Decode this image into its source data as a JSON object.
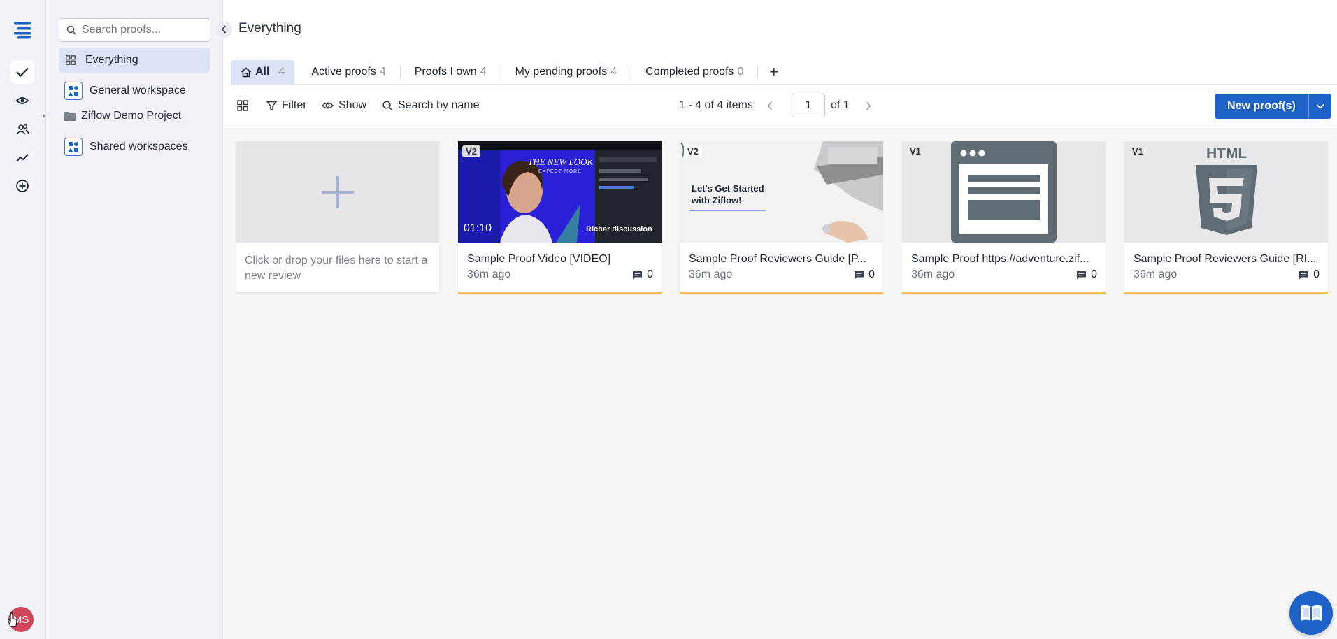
{
  "rail": {
    "avatar_initials": "MS"
  },
  "sidebar": {
    "search_placeholder": "Search proofs...",
    "items": [
      {
        "label": "Everything"
      },
      {
        "label": "General workspace"
      },
      {
        "label": "Ziflow Demo Project"
      },
      {
        "label": "Shared workspaces"
      }
    ]
  },
  "main": {
    "title": "Everything",
    "tabs": [
      {
        "label": "All",
        "count": "4"
      },
      {
        "label": "Active proofs",
        "count": "4"
      },
      {
        "label": "Proofs I own",
        "count": "4"
      },
      {
        "label": "My pending proofs",
        "count": "4"
      },
      {
        "label": "Completed proofs",
        "count": "0"
      }
    ],
    "tab_add": "+",
    "toolbar": {
      "filter": "Filter",
      "show": "Show",
      "search": "Search by name",
      "items_range": "1 - 4 of 4 items",
      "page": "1",
      "of_pages": "of 1",
      "new_button": "New proof(s)"
    },
    "upload_card": {
      "text": "Click or drop your files here to start a new review"
    },
    "cards": [
      {
        "version": "V2",
        "title": "Sample Proof Video [VIDEO]",
        "time": "36m ago",
        "comments": "0",
        "duration": "01:10",
        "thumb_headline": "THE NEW LOOK",
        "thumb_sub": "EXPECT MORE",
        "thumb_caption": "Richer discussion"
      },
      {
        "version": "V2",
        "title": "Sample Proof Reviewers Guide [P...",
        "time": "36m ago",
        "comments": "0",
        "thumb_line1": "Let's Get Started",
        "thumb_line2": "with Ziflow!"
      },
      {
        "version": "V1",
        "title": "Sample Proof https://adventure.zif...",
        "time": "36m ago",
        "comments": "0"
      },
      {
        "version": "V1",
        "title": "Sample Proof Reviewers Guide [RI...",
        "time": "36m ago",
        "comments": "0",
        "thumb_label": "HTML"
      }
    ]
  },
  "colors": {
    "accent": "#1e62c8",
    "selected_bg": "#dde3f7",
    "card_bar": "#f2c14e",
    "avatar": "#d0475c"
  }
}
